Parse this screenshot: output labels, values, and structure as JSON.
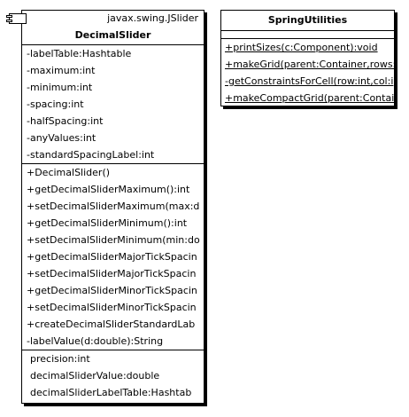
{
  "decimal_slider": {
    "stereotype": "javax.swing.JSlider",
    "name": "DecimalSlider",
    "attributes": [
      "-labelTable:Hashtable",
      "-maximum:int",
      "-minimum:int",
      "-spacing:int",
      "-halfSpacing:int",
      "-anyValues:int",
      "-standardSpacingLabel:int"
    ],
    "operations": [
      "+DecimalSlider()",
      "+getDecimalSliderMaximum():int",
      "+setDecimalSliderMaximum(max:d",
      "+getDecimalSliderMinimum():int",
      "+setDecimalSliderMinimum(min:do",
      "+getDecimalSliderMajorTickSpacin",
      "+setDecimalSliderMajorTickSpacin",
      "+getDecimalSliderMinorTickSpacin",
      "+setDecimalSliderMinorTickSpacin",
      "+createDecimalSliderStandardLab",
      "-labelValue(d:double):String"
    ],
    "properties": [
      "precision:int",
      "decimalSliderValue:double",
      "decimalSliderLabelTable:Hashtab"
    ]
  },
  "spring_utilities": {
    "name": "SpringUtilities",
    "operations": [
      "+printSizes(c:Component):void",
      "+makeGrid(parent:Container,rows:",
      "-getConstraintsForCell(row:int,col:i",
      "+makeCompactGrid(parent:Contai"
    ]
  }
}
